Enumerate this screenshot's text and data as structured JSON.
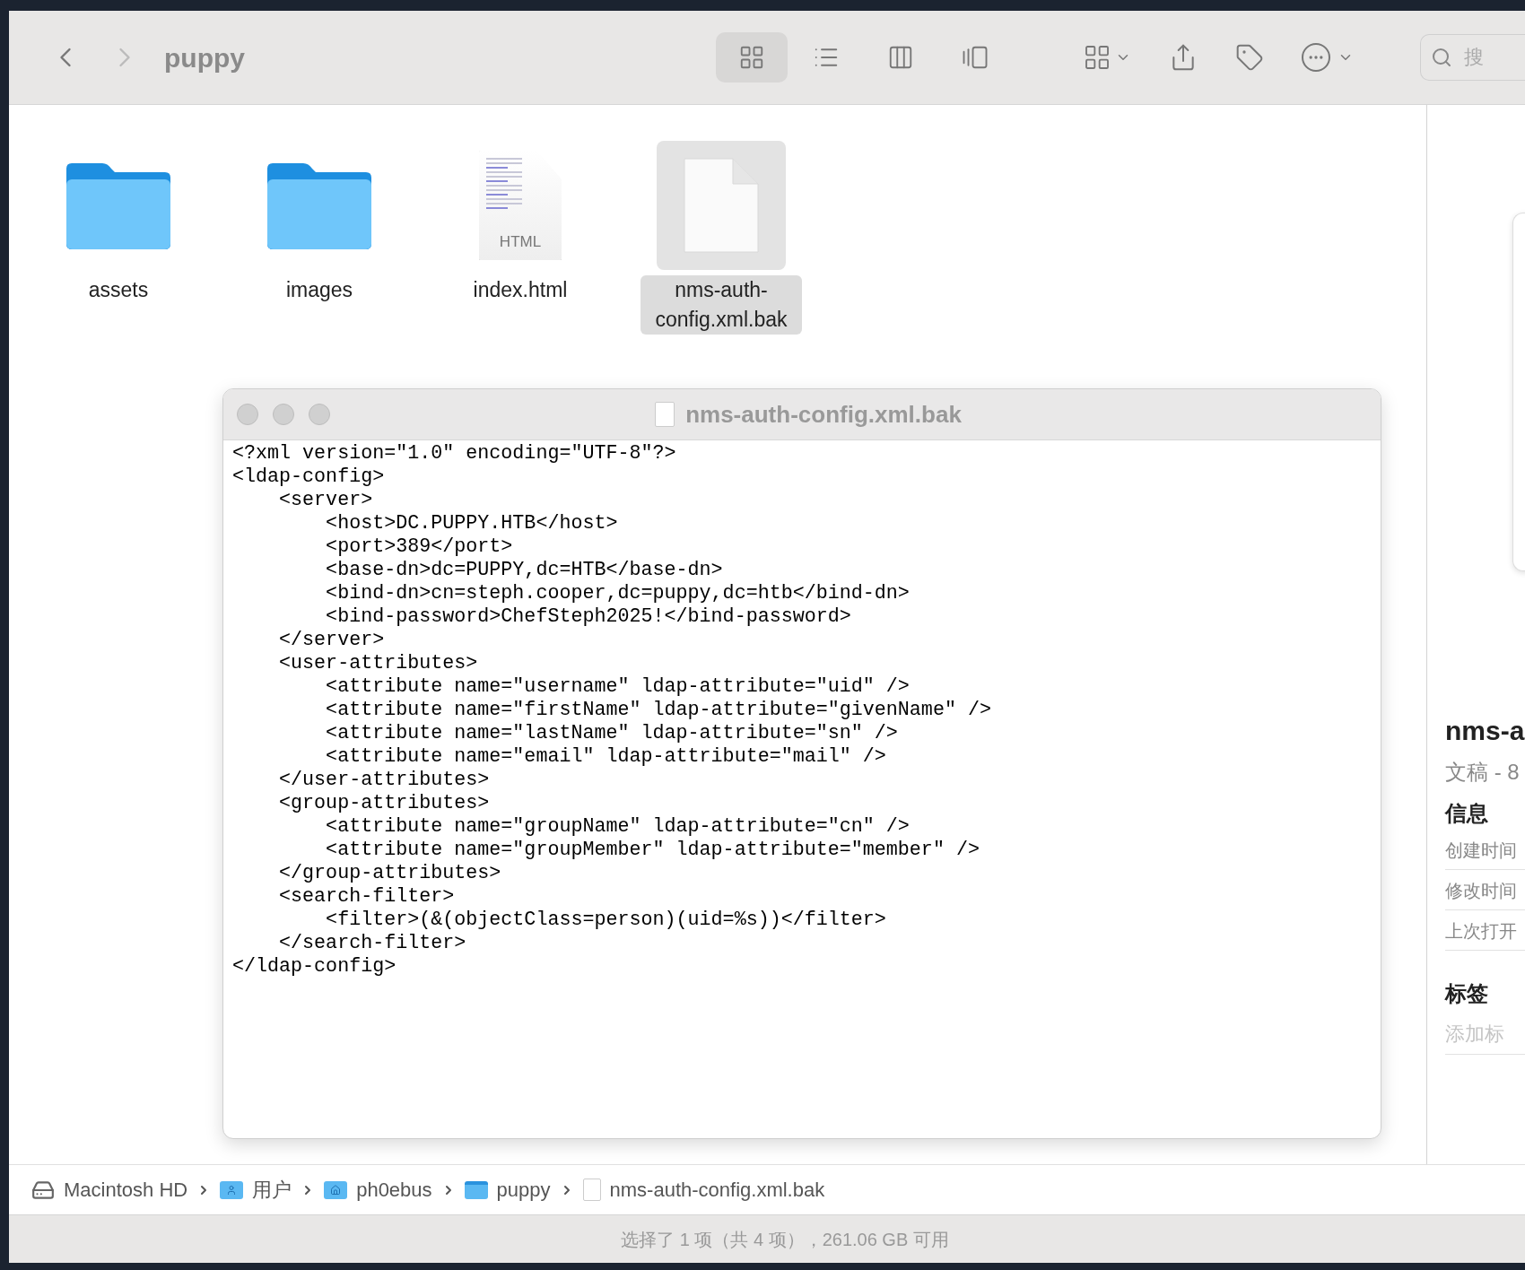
{
  "toolbar": {
    "title": "puppy",
    "forward_disabled": true,
    "views": [
      {
        "kind": "grid",
        "selected": true
      },
      {
        "kind": "list",
        "selected": false
      },
      {
        "kind": "columns",
        "selected": false
      },
      {
        "kind": "gallery",
        "selected": false
      }
    ],
    "search": {
      "placeholder": "搜"
    }
  },
  "files": [
    {
      "name": "assets",
      "kind": "folder",
      "selected": false
    },
    {
      "name": "images",
      "kind": "folder",
      "selected": false
    },
    {
      "name": "index.html",
      "kind": "html",
      "badge": "HTML",
      "selected": false
    },
    {
      "name": "nms-auth-config.xml.bak",
      "kind": "blank",
      "selected": true
    }
  ],
  "quicklook": {
    "title": "nms-auth-config.xml.bak",
    "lines": [
      "<?xml version=\"1.0\" encoding=\"UTF-8\"?>",
      "<ldap-config>",
      "    <server>",
      "        <host>DC.PUPPY.HTB</host>",
      "        <port>389</port>",
      "        <base-dn>dc=PUPPY,dc=HTB</base-dn>",
      "        <bind-dn>cn=steph.cooper,dc=puppy,dc=htb</bind-dn>",
      "        <bind-password>ChefSteph2025!</bind-password>",
      "    </server>",
      "    <user-attributes>",
      "        <attribute name=\"username\" ldap-attribute=\"uid\" />",
      "        <attribute name=\"firstName\" ldap-attribute=\"givenName\" />",
      "        <attribute name=\"lastName\" ldap-attribute=\"sn\" />",
      "        <attribute name=\"email\" ldap-attribute=\"mail\" />",
      "    </user-attributes>",
      "    <group-attributes>",
      "        <attribute name=\"groupName\" ldap-attribute=\"cn\" />",
      "        <attribute name=\"groupMember\" ldap-attribute=\"member\" />",
      "    </group-attributes>",
      "    <search-filter>",
      "        <filter>(&(objectClass=person)(uid=%s))</filter>",
      "    </search-filter>",
      "</ldap-config>"
    ]
  },
  "inspector": {
    "name": "nms-a",
    "kind_text": "文稿 - 8",
    "info_heading": "信息",
    "info_rows": [
      "创建时间",
      "修改时间",
      "上次打开"
    ],
    "tags_heading": "标签",
    "tags_placeholder": "添加标"
  },
  "path_bar": [
    {
      "label": "Macintosh HD",
      "kind": "disk"
    },
    {
      "label": "用户",
      "kind": "user-folder"
    },
    {
      "label": "ph0ebus",
      "kind": "home-folder"
    },
    {
      "label": "puppy",
      "kind": "folder"
    },
    {
      "label": "nms-auth-config.xml.bak",
      "kind": "file"
    }
  ],
  "status": "选择了 1 项（共 4 项），261.06 GB 可用"
}
